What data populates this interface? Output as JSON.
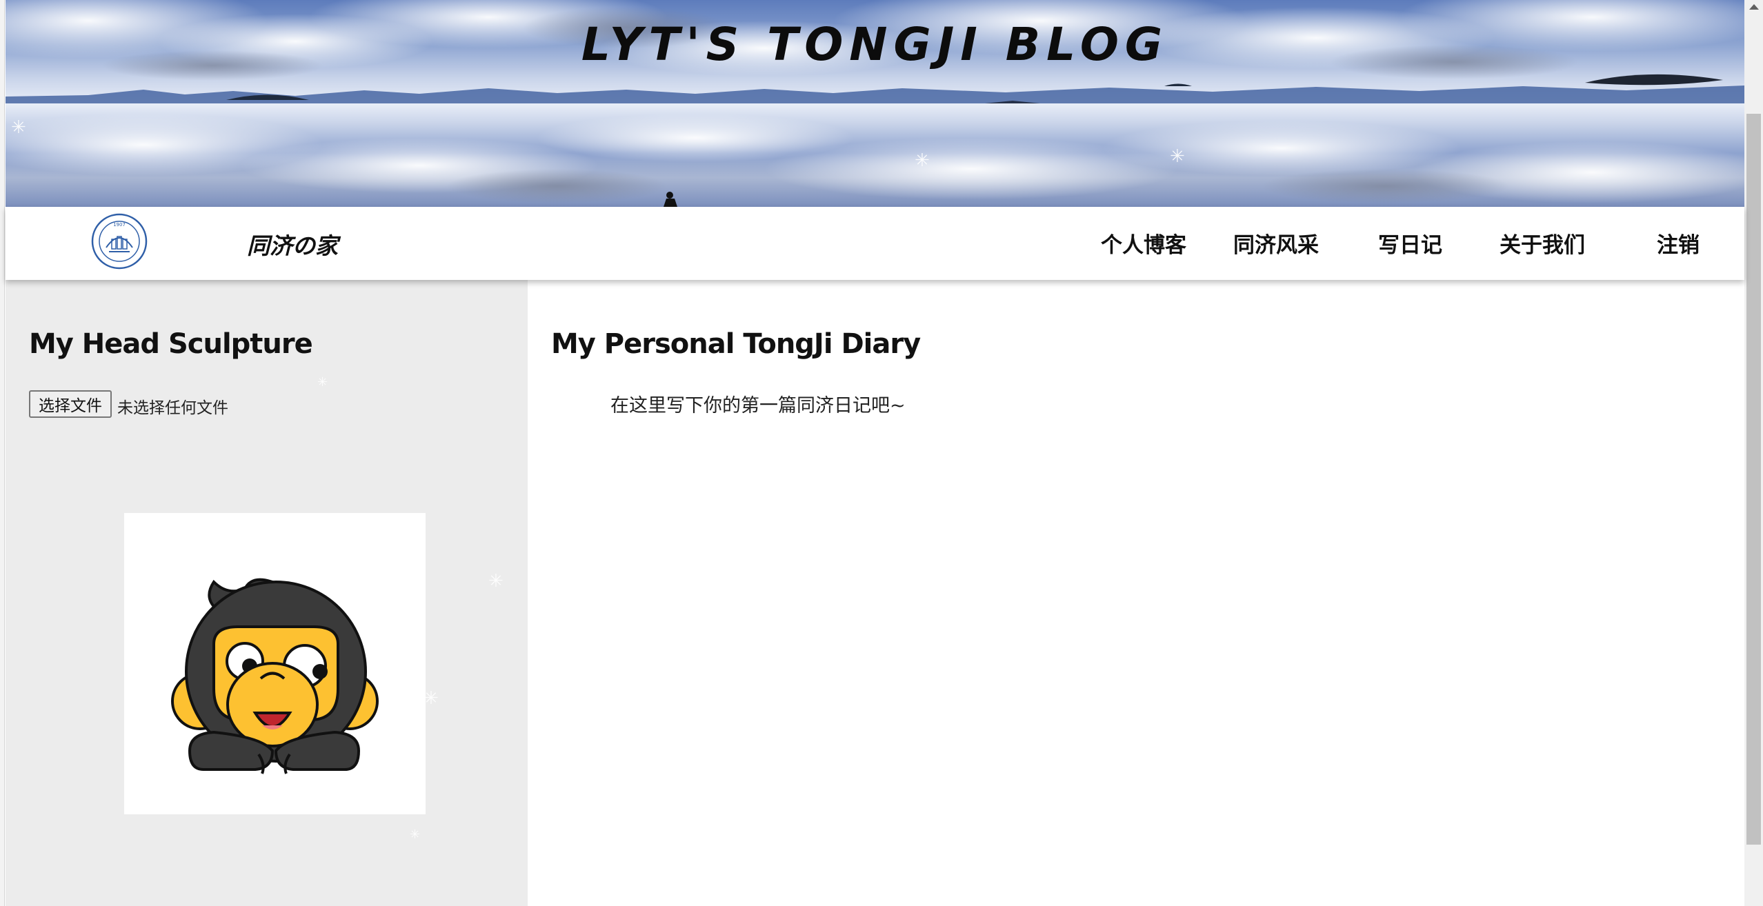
{
  "banner": {
    "title": "LYT'S TONGJI BLOG"
  },
  "navbar": {
    "logo_icon": "tongji-university-seal-icon",
    "site_name": "同济の家",
    "items": [
      {
        "label": "个人博客"
      },
      {
        "label": "同济风采"
      },
      {
        "label": "写日记"
      },
      {
        "label": "关于我们"
      },
      {
        "label": "注销"
      }
    ]
  },
  "left_panel": {
    "title": "My Head Sculpture",
    "file_button": "选择文件",
    "file_status": "未选择任何文件",
    "avatar_icon": "monkey-avatar"
  },
  "right_panel": {
    "title": "My Personal TongJi Diary",
    "placeholder": "在这里写下你的第一篇同济日记吧~"
  },
  "colors": {
    "left_panel_bg": "#ececec",
    "navbar_bg": "#ffffff",
    "text": "#111111"
  }
}
